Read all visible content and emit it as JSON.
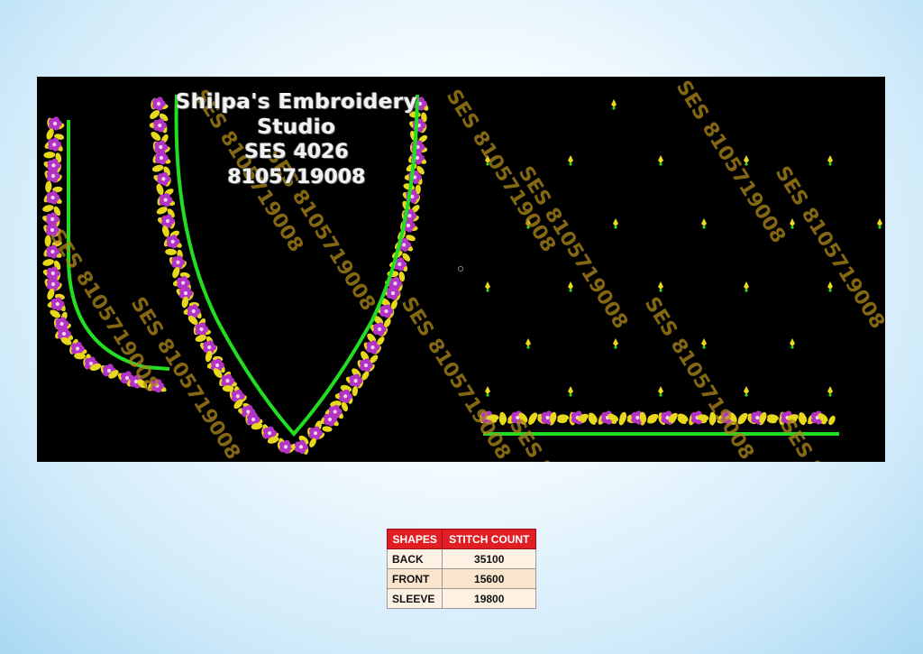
{
  "studio": {
    "name": "Shilpa's Embroidery Studio",
    "design_code": "SES 4026",
    "phone": "8105719008"
  },
  "watermark": "SES 8105719008",
  "colors": {
    "panel": "#000000",
    "outline_green": "#22dd22",
    "leaf_yellow": "#e8d81c",
    "flower_purple": "#b233c4",
    "table_header": "#e01e24"
  },
  "table": {
    "headers": [
      "SHAPES",
      "STITCH COUNT"
    ],
    "rows": [
      {
        "shape": "BACK",
        "count": "35100"
      },
      {
        "shape": "FRONT",
        "count": "15600"
      },
      {
        "shape": "SLEEVE",
        "count": "19800"
      }
    ]
  }
}
